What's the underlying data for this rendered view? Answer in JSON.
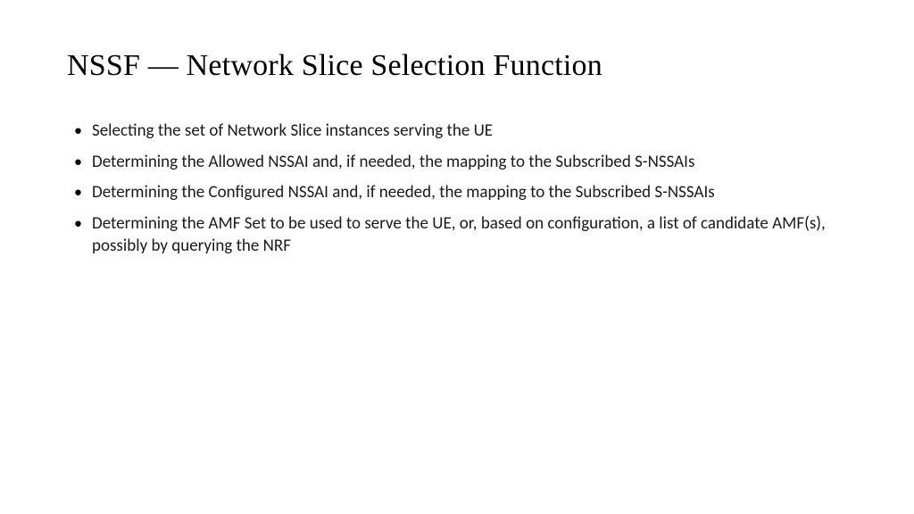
{
  "slide": {
    "title": "NSSF — Network Slice Selection Function",
    "bullets": [
      "Selecting the set of Network Slice instances serving the UE",
      "Determining the Allowed NSSAI and, if needed, the mapping to the Subscribed S-NSSAIs",
      "Determining the Configured NSSAI and, if needed, the mapping to the Subscribed S-NSSAIs",
      "Determining the AMF Set to be used to serve the UE, or, based on configuration, a list of candidate AMF(s), possibly by querying the NRF"
    ]
  }
}
